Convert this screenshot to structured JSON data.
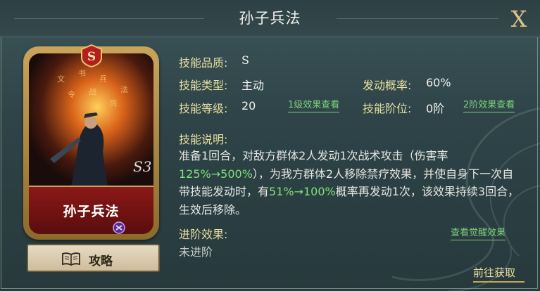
{
  "header": {
    "title": "孙子兵法",
    "close_label": "X"
  },
  "card": {
    "name": "孙子兵法",
    "grade": "S",
    "art_text": "风 林 火 山"
  },
  "guide_button": {
    "label": "攻略"
  },
  "info": {
    "quality_label": "技能品质:",
    "quality_value": "S",
    "type_label": "技能类型:",
    "type_value": "主动",
    "trigger_label": "发动概率:",
    "trigger_value": "60%",
    "level_label": "技能等级:",
    "level_value": "20",
    "level_link": "1级效果查看",
    "tier_label": "技能阶位:",
    "tier_value": "0阶",
    "tier_link": "2阶效果查看"
  },
  "description": {
    "label": "技能说明:",
    "part1": "准备1回合，对敌方群体2人发动1次战术攻击（伤害率",
    "hl1": "125%→500%",
    "part2": "），为我方群体2人移除禁疗效果，并使自身下一次自带技能发动时，有",
    "hl2": "51%→100%",
    "part3": "概率再发动1次，该效果持续3回合，生效后移除。"
  },
  "advance": {
    "label": "进阶效果:",
    "value": "未进阶",
    "link": "查看觉醒效果"
  },
  "obtain_button": {
    "label": "前往获取"
  },
  "colors": {
    "label_yellow": "#e9dfa0",
    "highlight_green": "#7fe07a",
    "card_red": "#8b1818",
    "gold": "#c9a45a"
  }
}
